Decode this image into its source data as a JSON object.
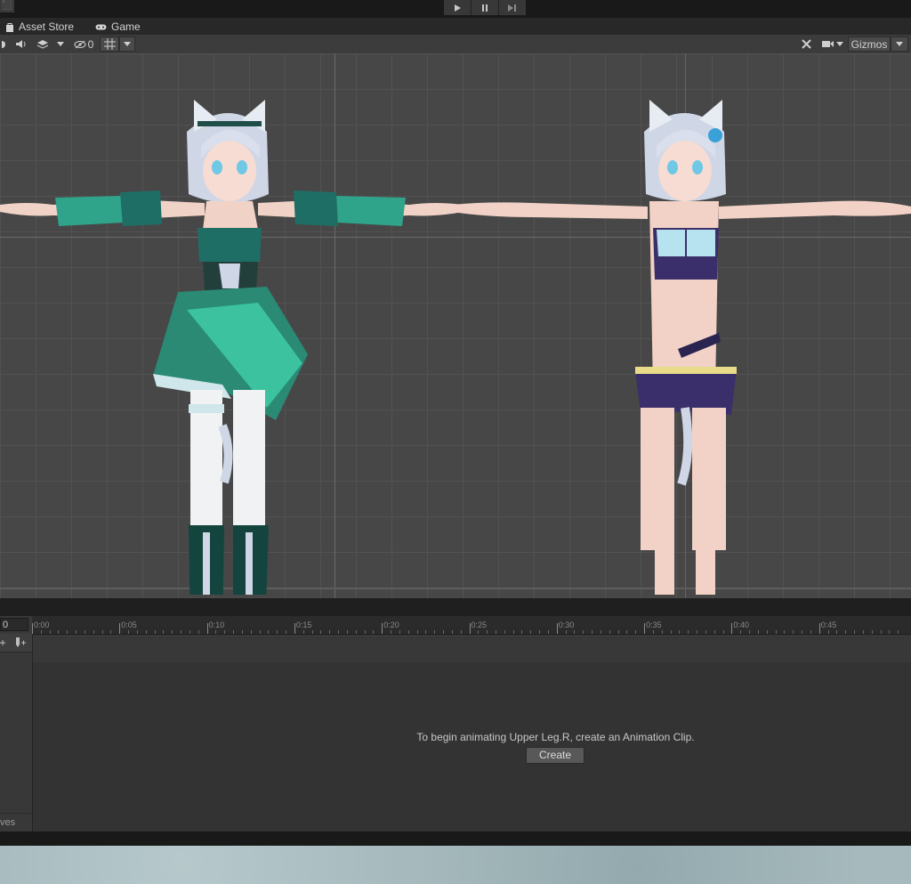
{
  "window": {
    "play_controls": [
      "play",
      "pause",
      "step"
    ]
  },
  "tabs": [
    {
      "label": "Asset Store",
      "icon": "shopping-bag-icon"
    },
    {
      "label": "Game",
      "icon": "gamepad-icon"
    }
  ],
  "scene_toolbar": {
    "hidden_count": "0",
    "gizmos_label": "Gizmos"
  },
  "scene": {
    "characters": [
      {
        "name": "character-outfit",
        "description_icon": "humanoid-model"
      },
      {
        "name": "character-swimsuit",
        "description_icon": "humanoid-model"
      }
    ]
  },
  "animation": {
    "frame_value": "0",
    "ruler_labels": [
      "0:00",
      "0:05",
      "0:10",
      "0:15",
      "0:20",
      "0:25",
      "0:30",
      "0:35",
      "0:40",
      "0:45"
    ],
    "left_panel_bottom": "ves",
    "message": "To begin animating Upper Leg.R, create an Animation Clip.",
    "create_label": "Create"
  }
}
